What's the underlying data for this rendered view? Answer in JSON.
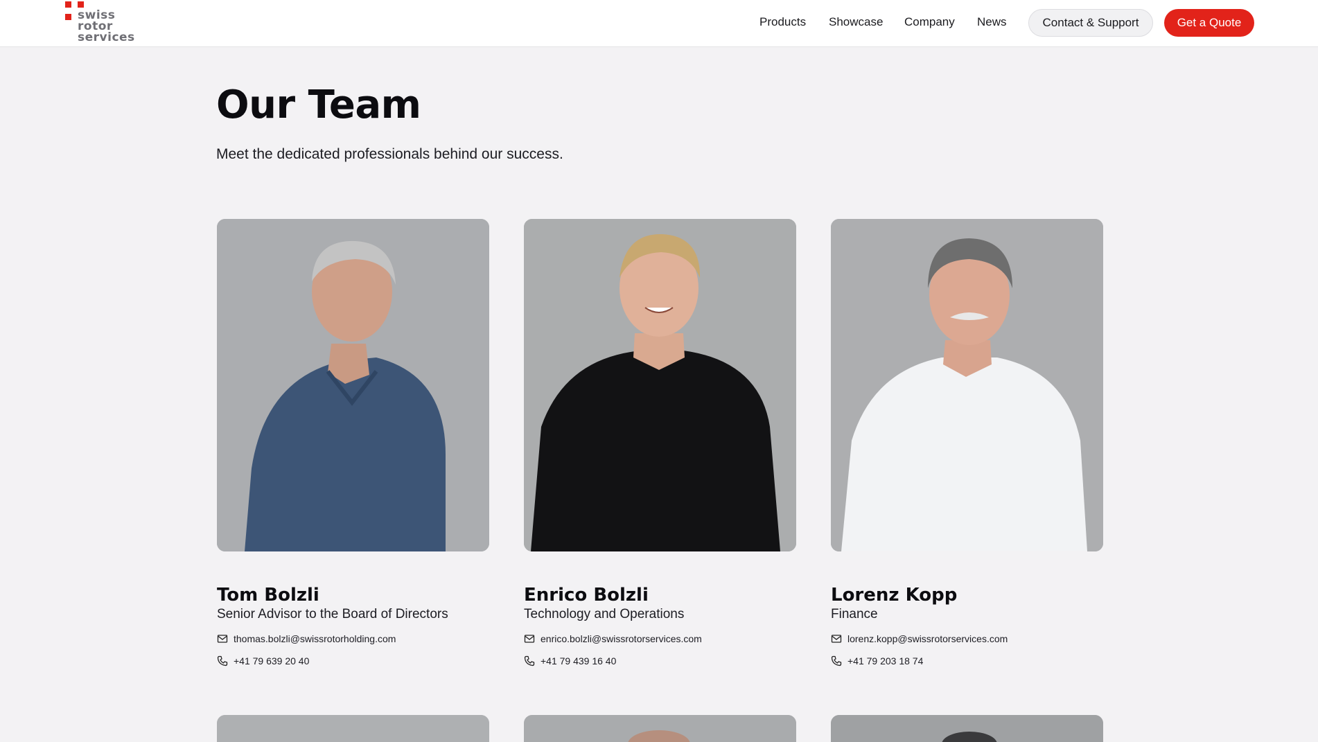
{
  "brand": {
    "logo_lines": [
      "swiss",
      "rotor",
      "services"
    ],
    "accent": "#e2231a"
  },
  "nav": {
    "links": [
      "Products",
      "Showcase",
      "Company",
      "News"
    ],
    "contact_label": "Contact & Support",
    "quote_label": "Get a Quote"
  },
  "main": {
    "title": "Our Team",
    "subtitle": "Meet the dedicated professionals behind our success."
  },
  "team": [
    {
      "name": "Tom Bolzli",
      "role": "Senior Advisor to the Board of Directors",
      "email": "thomas.bolzli@swissrotorholding.com",
      "phone": "+41 79 639 20 40",
      "shirt_color": "#3d5576"
    },
    {
      "name": "Enrico Bolzli",
      "role": "Technology and Operations",
      "email": "enrico.bolzli@swissrotorservices.com",
      "phone": "+41 79 439 16 40",
      "shirt_color": "#121214"
    },
    {
      "name": "Lorenz Kopp",
      "role": "Finance",
      "email": "lorenz.kopp@swissrotorservices.com",
      "phone": "+41 79 203 18 74",
      "shirt_color": "#f2f3f5"
    }
  ],
  "icons": {
    "email": "mail-icon",
    "phone": "phone-icon"
  }
}
